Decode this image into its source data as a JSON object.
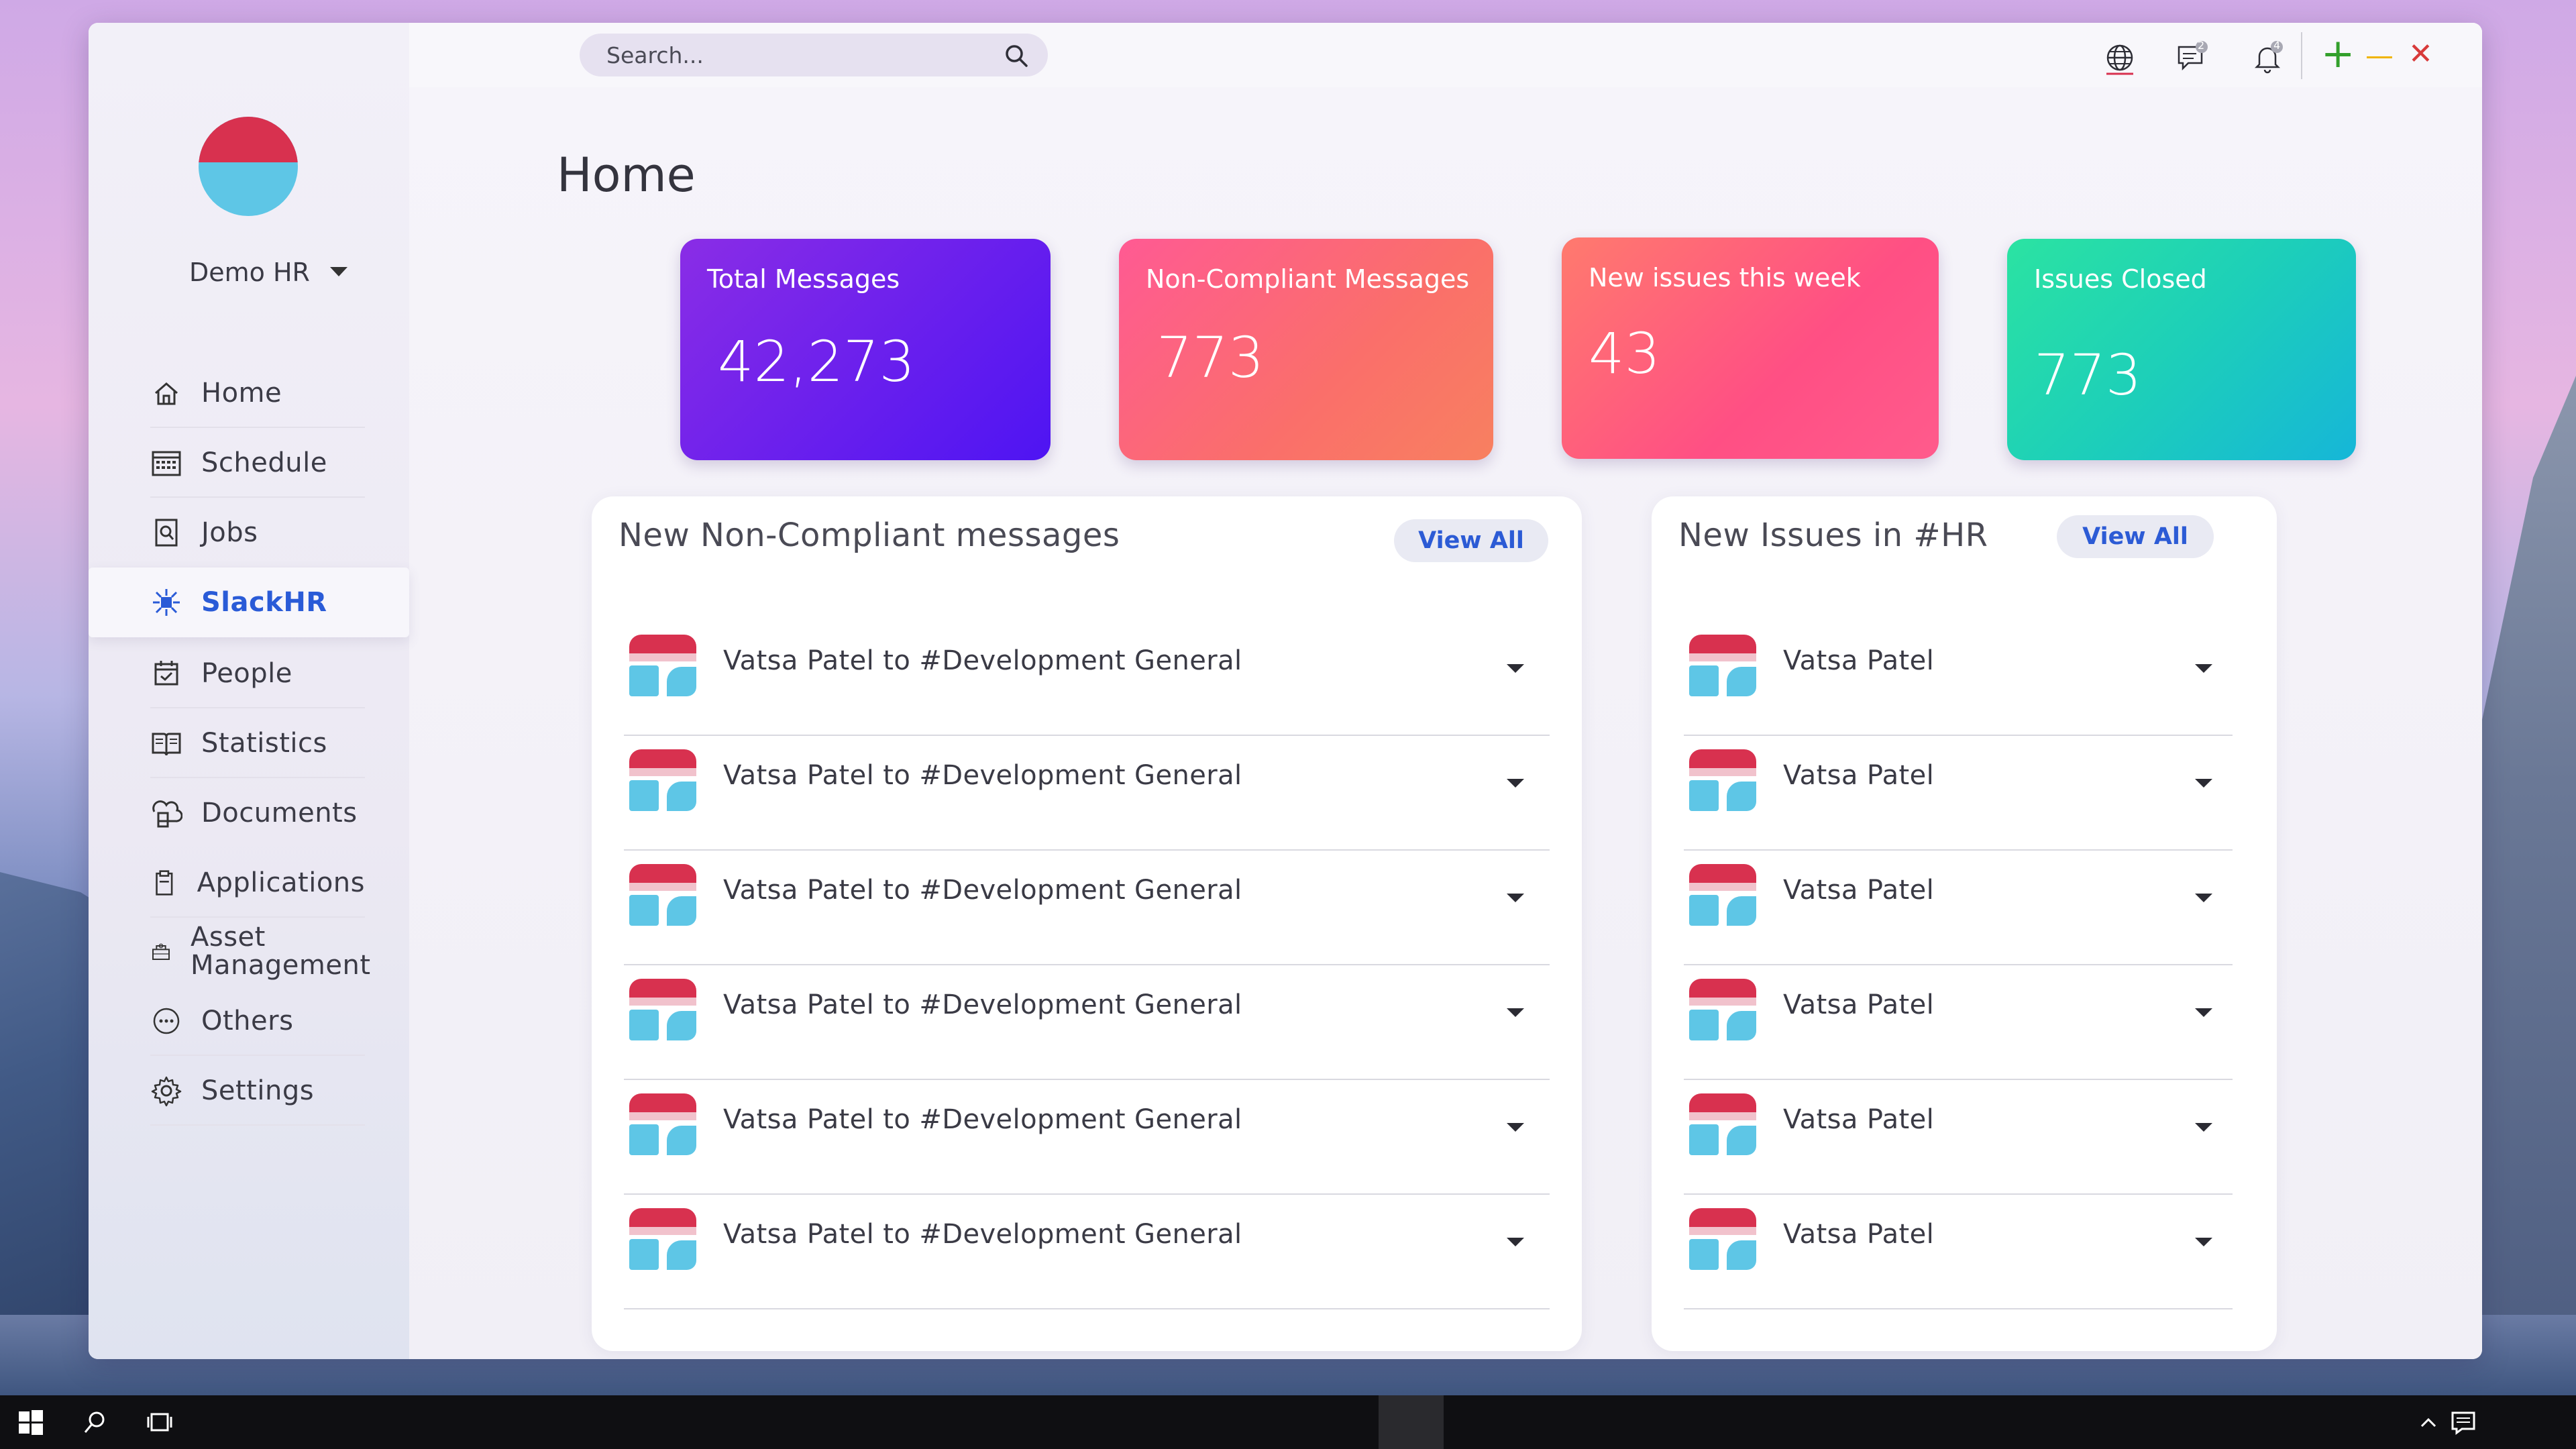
{
  "window": {
    "controls": {
      "add": "+",
      "minimize": "—",
      "close": "✕"
    }
  },
  "search": {
    "placeholder": "Search..."
  },
  "topbar": {
    "messages_badge": "2",
    "notifications_badge": "4"
  },
  "user": {
    "name": "Demo HR"
  },
  "nav": [
    {
      "label": "Home",
      "icon": "home-icon"
    },
    {
      "label": "Schedule",
      "icon": "calendar-icon"
    },
    {
      "label": "Jobs",
      "icon": "document-search-icon"
    },
    {
      "label": "SlackHR",
      "icon": "hub-icon",
      "active": true
    },
    {
      "label": "People",
      "icon": "calendar-check-icon"
    },
    {
      "label": "Statistics",
      "icon": "book-icon"
    },
    {
      "label": "Documents",
      "icon": "documents-icon"
    },
    {
      "label": "Applications",
      "icon": "clipboard-icon"
    },
    {
      "label": "Asset Management",
      "icon": "asset-icon"
    },
    {
      "label": "Others",
      "icon": "more-icon"
    },
    {
      "label": "Settings",
      "icon": "gear-icon"
    }
  ],
  "page": {
    "title": "Home"
  },
  "stats": [
    {
      "label": "Total Messages",
      "value": "42,273"
    },
    {
      "label": "Non-Compliant Messages",
      "value": "773"
    },
    {
      "label": "New issues this week",
      "value": "43"
    },
    {
      "label": "Issues Closed",
      "value": "773"
    }
  ],
  "noncompliant": {
    "title": "New Non-Compliant messages",
    "view_all": "View All",
    "rows": [
      "Vatsa Patel to #Development General",
      "Vatsa Patel to #Development General",
      "Vatsa Patel to #Development General",
      "Vatsa Patel to #Development General",
      "Vatsa Patel to #Development General",
      "Vatsa Patel to #Development General"
    ]
  },
  "issues": {
    "title": "New Issues in #HR",
    "view_all": "View All",
    "rows": [
      "Vatsa Patel",
      "Vatsa Patel",
      "Vatsa Patel",
      "Vatsa Patel",
      "Vatsa Patel",
      "Vatsa Patel"
    ]
  },
  "colors": {
    "accent": "#2a5bd7",
    "brand_red": "#d8314f",
    "brand_blue": "#5ec6e6"
  }
}
